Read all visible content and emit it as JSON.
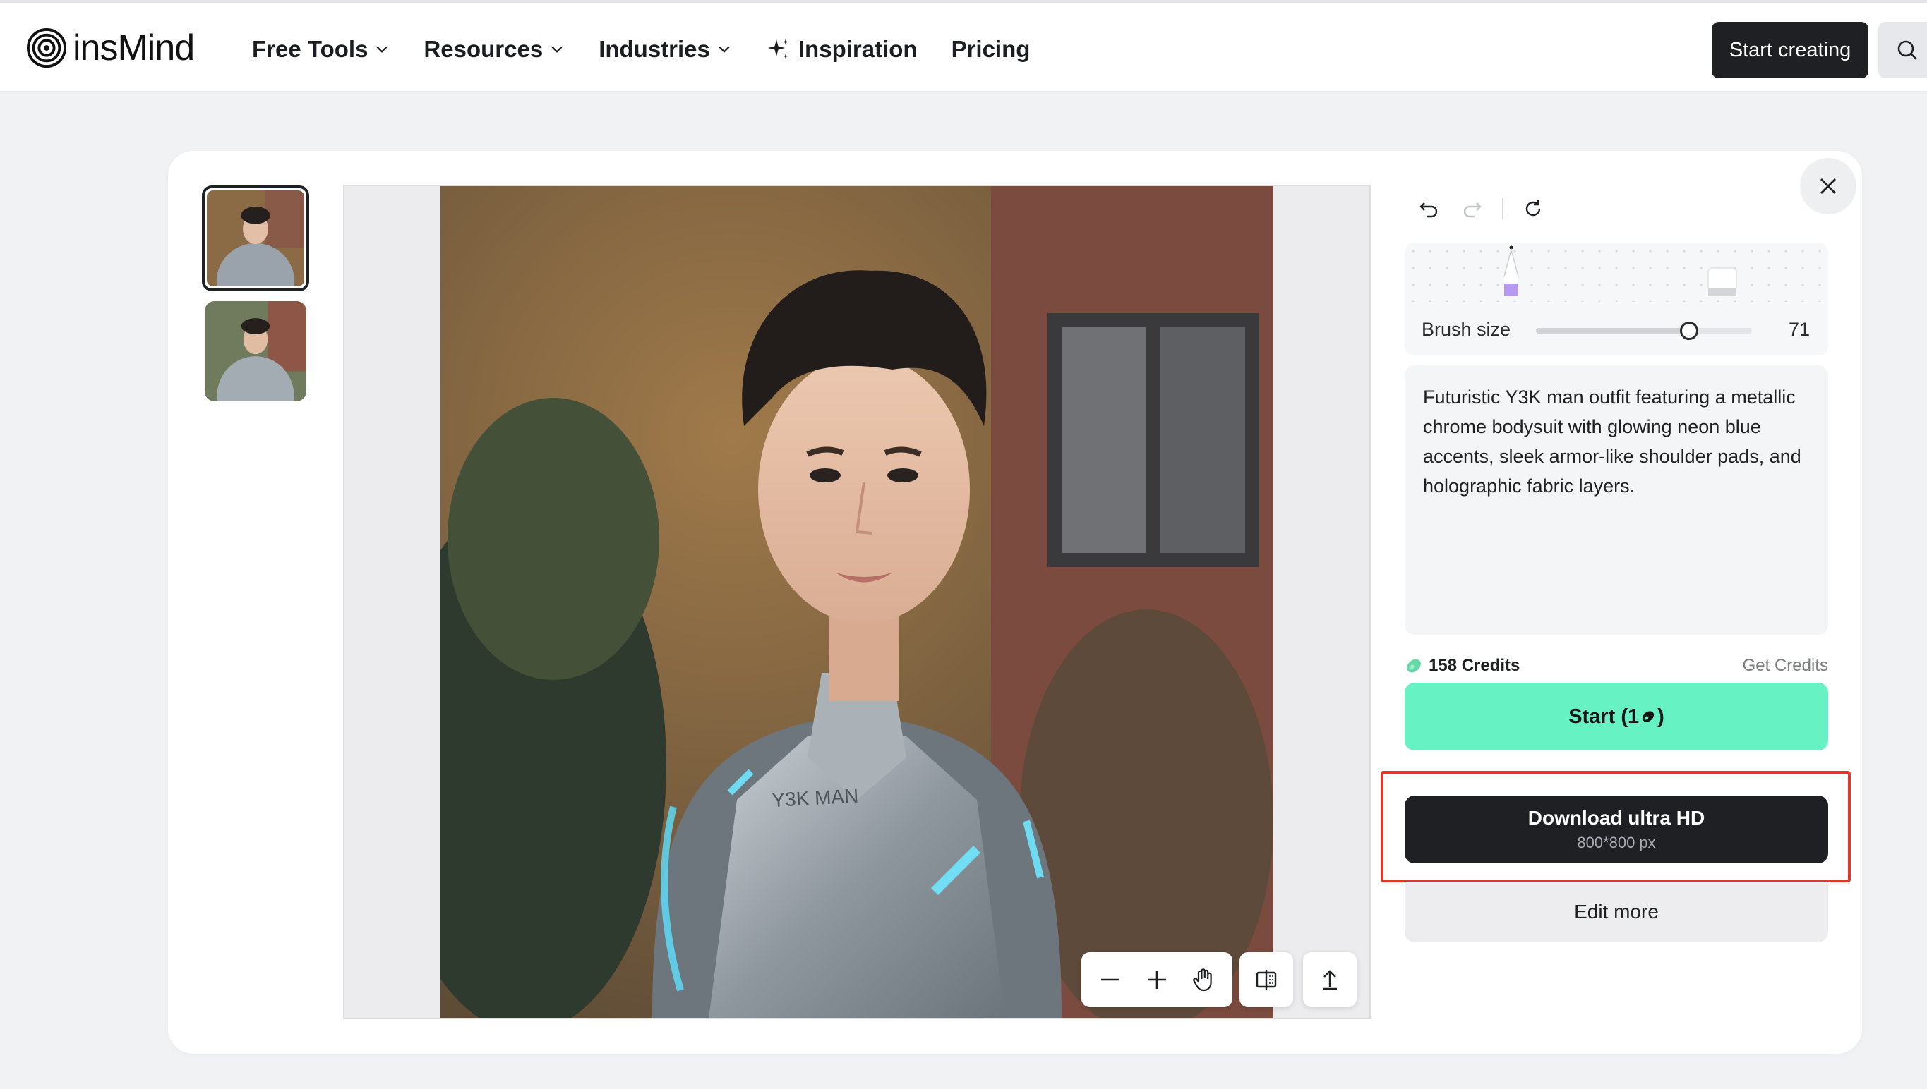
{
  "brand": {
    "name": "insMind",
    "logo_icon": "insmind-logo-icon"
  },
  "nav": {
    "items": [
      {
        "label": "Free Tools",
        "has_dropdown": true
      },
      {
        "label": "Resources",
        "has_dropdown": true
      },
      {
        "label": "Industries",
        "has_dropdown": true
      },
      {
        "label": "Inspiration",
        "icon": "sparkle-icon"
      },
      {
        "label": "Pricing"
      }
    ],
    "start_creating": "Start creating",
    "search_icon": "search-icon"
  },
  "editor": {
    "thumbnails_count": 2,
    "active_thumbnail": 1,
    "zoom_tools": [
      "zoom-out-icon",
      "zoom-in-icon",
      "hand-pan-icon"
    ],
    "extra_tools": [
      "compare-icon",
      "upload-icon"
    ]
  },
  "panel": {
    "brush_label": "Brush size",
    "brush_value": "71",
    "brush_fraction": 0.71,
    "prompt": "Futuristic Y3K man outfit featuring a metallic chrome bodysuit with glowing neon blue accents, sleek armor-like shoulder pads, and holographic fabric layers.",
    "credits_label": "158 Credits",
    "get_credits": "Get Credits",
    "start_prefix": "Start (1",
    "start_suffix": ")",
    "download_title": "Download ultra HD",
    "download_sub": "800*800 px",
    "edit_more": "Edit more"
  },
  "colors": {
    "accent_mint": "#67f2c4",
    "dark": "#1f2023",
    "highlight_red": "#e0392b",
    "pen_purple": "#b69af0"
  }
}
